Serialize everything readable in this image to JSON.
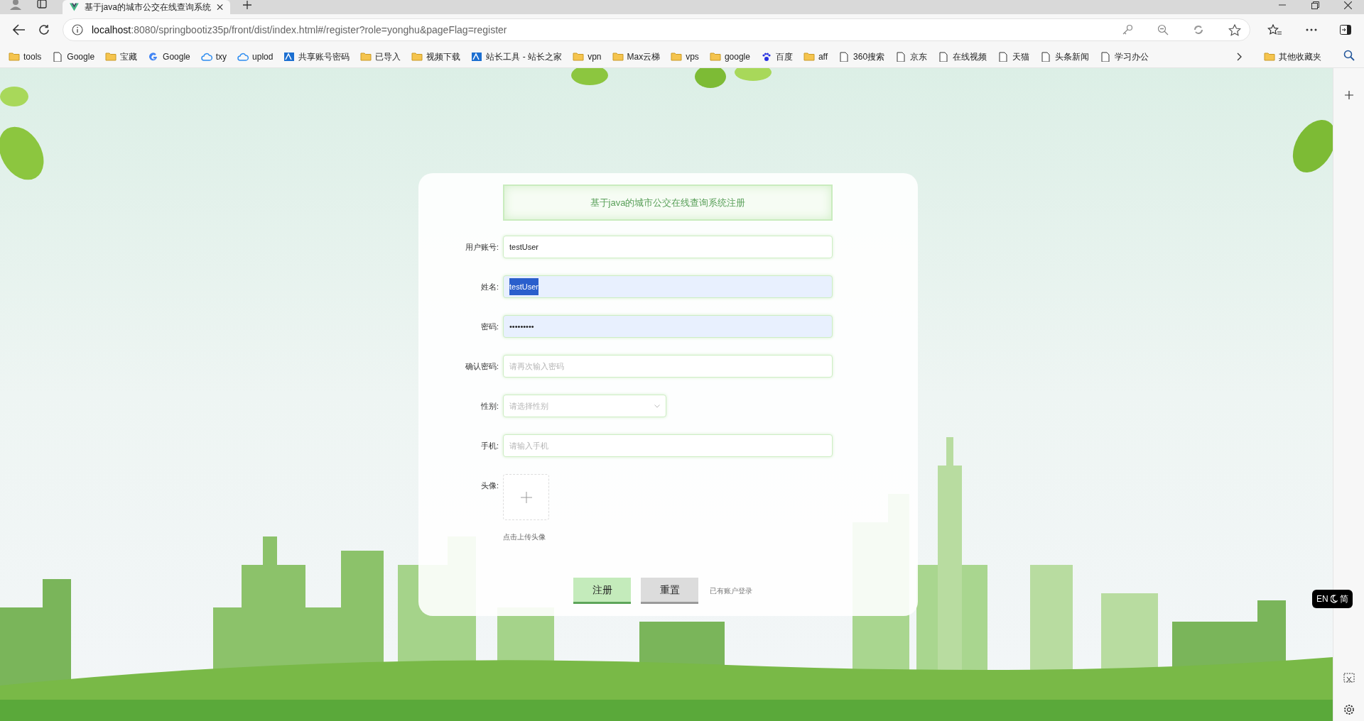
{
  "browser": {
    "tab": {
      "title": "基于java的城市公交在线查询系统",
      "selected": true
    },
    "url_host": "localhost",
    "url_rest": ":8080/springbootiz35p/front/dist/index.html#/register?role=yonghu&pageFlag=register",
    "bookmarks": [
      {
        "kind": "folder",
        "label": "tools"
      },
      {
        "kind": "page",
        "label": "Google"
      },
      {
        "kind": "folder",
        "label": "宝藏"
      },
      {
        "kind": "google",
        "label": "Google"
      },
      {
        "kind": "cloud",
        "label": "txy"
      },
      {
        "kind": "cloud",
        "label": "uplod"
      },
      {
        "kind": "app",
        "label": "共享账号密码"
      },
      {
        "kind": "folder",
        "label": "已导入"
      },
      {
        "kind": "folder",
        "label": "视频下载"
      },
      {
        "kind": "app",
        "label": "站长工具 - 站长之家"
      },
      {
        "kind": "folder",
        "label": "vpn"
      },
      {
        "kind": "folder",
        "label": "Max云梯"
      },
      {
        "kind": "folder",
        "label": "vps"
      },
      {
        "kind": "folder",
        "label": "google"
      },
      {
        "kind": "paw",
        "label": "百度"
      },
      {
        "kind": "folder",
        "label": "aff"
      },
      {
        "kind": "page",
        "label": "360搜索"
      },
      {
        "kind": "page",
        "label": "京东"
      },
      {
        "kind": "page",
        "label": "在线视频"
      },
      {
        "kind": "page",
        "label": "天猫"
      },
      {
        "kind": "page",
        "label": "头条新闻"
      },
      {
        "kind": "page",
        "label": "学习办公"
      }
    ],
    "other_bookmarks": "其他收藏夹"
  },
  "form": {
    "title": "基于java的城市公交在线查询系统注册",
    "fields": [
      {
        "kind": "text",
        "label": "用户账号:",
        "value": "testUser",
        "autofilled": false
      },
      {
        "kind": "text",
        "label": "姓名:",
        "value": "testUser",
        "autofilled": true,
        "text_selected": true
      },
      {
        "kind": "text",
        "label": "密码:",
        "value": "•••••••••",
        "autofilled": true
      },
      {
        "kind": "text",
        "label": "确认密码:",
        "placeholder": "请再次输入密码",
        "autofilled": false
      },
      {
        "kind": "select",
        "label": "性别:",
        "placeholder": "请选择性别"
      },
      {
        "kind": "text",
        "label": "手机:",
        "placeholder": "请输入手机",
        "autofilled": false
      },
      {
        "kind": "upload",
        "label": "头像:",
        "hint": "点击上传头像"
      }
    ],
    "buttons": [
      {
        "kind": "primary",
        "label": "注册"
      },
      {
        "kind": "secondary",
        "label": "重置"
      }
    ],
    "login_link": "已有账户登录"
  },
  "ime": {
    "left": "EN",
    "right": "简"
  }
}
